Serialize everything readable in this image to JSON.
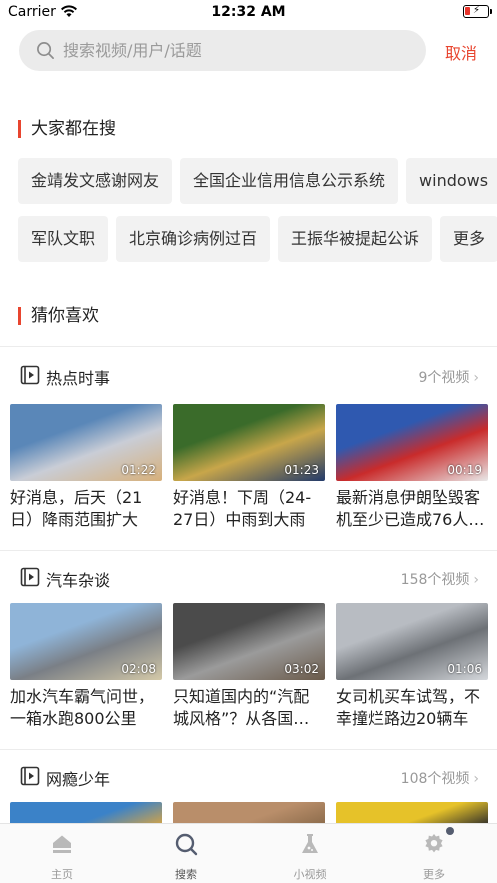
{
  "status_bar": {
    "carrier": "Carrier",
    "time": "12:32 AM"
  },
  "search": {
    "placeholder": "搜索视频/用户/话题",
    "cancel_label": "取消"
  },
  "hot_search": {
    "title": "大家都在搜",
    "row1": [
      "金靖发文感谢网友",
      "全国企业信用信息公示系统",
      "windows"
    ],
    "row2": [
      "军队文职",
      "北京确诊病例过百",
      "王振华被提起公诉",
      "更多"
    ]
  },
  "guess": {
    "title": "猜你喜欢"
  },
  "categories": [
    {
      "title": "热点时事",
      "count": "9个视频",
      "videos": [
        {
          "title": "好消息，后天（21日）降雨范围扩大",
          "duration": "01:22",
          "palette": [
            "#5a87b8",
            "#c9cdd6",
            "#d7b07a"
          ]
        },
        {
          "title": "好消息！下周（24-27日）中雨到大雨",
          "duration": "01:23",
          "palette": [
            "#3a6b2a",
            "#c8a64a",
            "#223a6a"
          ]
        },
        {
          "title": "最新消息伊朗坠毁客机至少已造成76人遇难",
          "duration": "00:19",
          "palette": [
            "#2f59b0",
            "#c92b2b",
            "#e8e8e8"
          ]
        }
      ]
    },
    {
      "title": "汽车杂谈",
      "count": "158个视频",
      "videos": [
        {
          "title": "加水汽车霸气问世，一箱水跑800公里",
          "duration": "02:08",
          "palette": [
            "#8fb4d8",
            "#7a7f86",
            "#d4c9a8"
          ]
        },
        {
          "title": "只知道国内的“汽配城风格”？从各国改装看",
          "duration": "03:02",
          "palette": [
            "#4b4b4b",
            "#9b9b9b",
            "#6a5a4a"
          ]
        },
        {
          "title": "女司机买车试驾，不幸撞烂路边20辆车",
          "duration": "01:06",
          "palette": [
            "#b8bcc2",
            "#6d7176",
            "#d5d8dc"
          ]
        }
      ]
    },
    {
      "title": "网瘾少年",
      "count": "108个视频",
      "videos": [
        {
          "title": "",
          "duration": "",
          "palette": [
            "#3b82c8",
            "#d9a441",
            "#6aa84f"
          ]
        },
        {
          "title": "",
          "duration": "",
          "palette": [
            "#b98e6a",
            "#8a6a4a",
            "#cdb59a"
          ]
        },
        {
          "title": "",
          "duration": "",
          "palette": [
            "#e6c229",
            "#2a2a2a",
            "#c94b2b"
          ]
        }
      ]
    }
  ],
  "tabbar": [
    {
      "label": "主页",
      "icon": "home-icon"
    },
    {
      "label": "搜索",
      "icon": "search-icon"
    },
    {
      "label": "小视频",
      "icon": "flask-icon"
    },
    {
      "label": "更多",
      "icon": "gear-icon"
    }
  ],
  "colors": {
    "accent": "#e8452f",
    "tab_active": "#555d70"
  }
}
